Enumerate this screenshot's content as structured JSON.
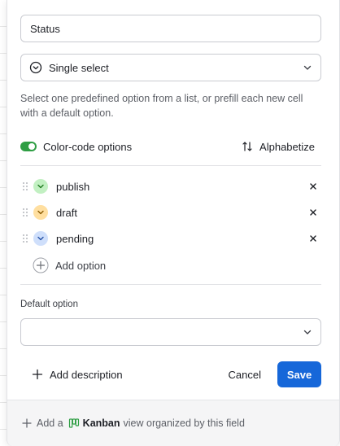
{
  "field": {
    "name_value": "Status",
    "name_placeholder": "Field name"
  },
  "type_select": {
    "icon": "chevron-circle-icon",
    "label": "Single select"
  },
  "description": "Select one predefined option from a list, or prefill each new cell with a default option.",
  "color_code": {
    "label": "Color-code options",
    "enabled": true,
    "toggle_color": "#2f9e44"
  },
  "alphabetize_label": "Alphabetize",
  "options": [
    {
      "label": "publish",
      "color": "#c2f0c2",
      "chevron_color": "#1f7a1f"
    },
    {
      "label": "draft",
      "color": "#ffdfa0",
      "chevron_color": "#8a5a00"
    },
    {
      "label": "pending",
      "color": "#cfdffb",
      "chevron_color": "#2451a6"
    }
  ],
  "add_option_label": "Add option",
  "default_option": {
    "label": "Default option",
    "value": ""
  },
  "footer": {
    "add_description_label": "Add description",
    "cancel_label": "Cancel",
    "save_label": "Save",
    "save_color": "#1667d9"
  },
  "bottom_bar": {
    "prefix": "Add a",
    "view_name": "Kanban",
    "suffix": "view organized by this field",
    "kanban_icon_color": "#2f9e44"
  }
}
